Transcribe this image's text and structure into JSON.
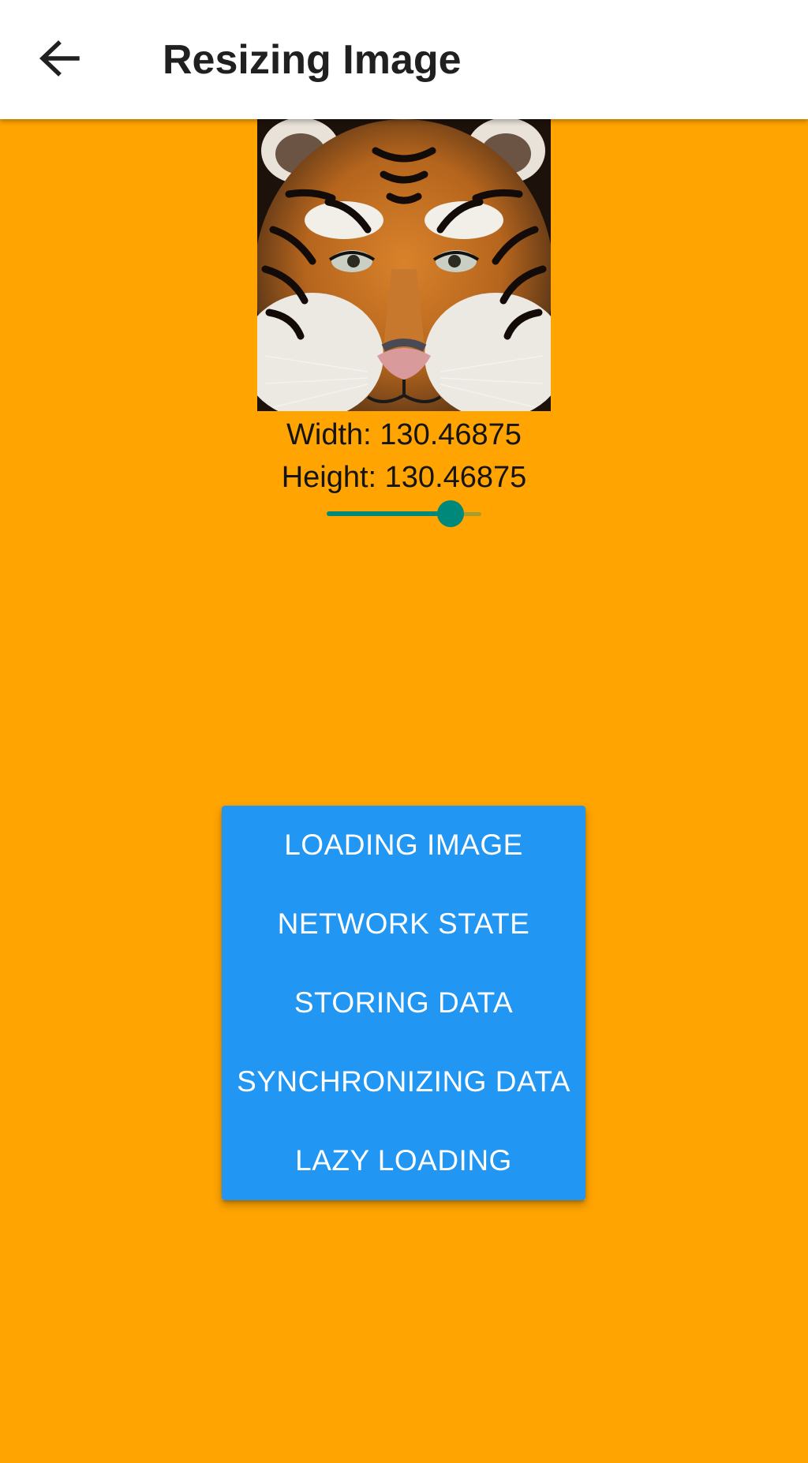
{
  "app_bar": {
    "title": "Resizing Image",
    "back_icon": "arrow-left-icon",
    "background": "#FFFFFF"
  },
  "background_color": "#FFA400",
  "image": {
    "subject": "tiger face photo"
  },
  "dimensions": {
    "width_text": "Width: 130.46875",
    "height_text": "Height: 130.46875"
  },
  "slider": {
    "value_fraction": 0.8,
    "active_color": "#00897B"
  },
  "buttons": [
    {
      "label": "LOADING IMAGE"
    },
    {
      "label": "NETWORK STATE"
    },
    {
      "label": "STORING DATA"
    },
    {
      "label": "SYNCHRONIZING DATA"
    },
    {
      "label": "LAZY LOADING"
    }
  ],
  "button_color": "#2196F3"
}
